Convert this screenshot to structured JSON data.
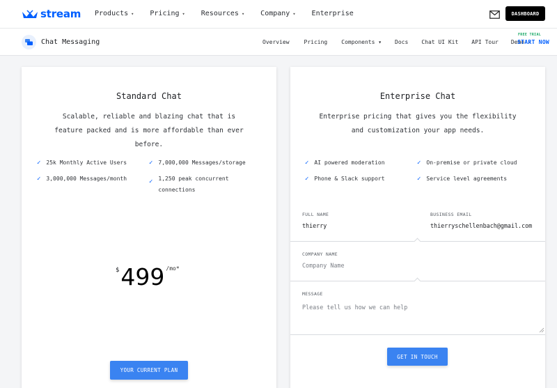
{
  "topnav": {
    "logo_text": "stream",
    "items": [
      {
        "label": "Products",
        "caret": true
      },
      {
        "label": "Pricing",
        "caret": true
      },
      {
        "label": "Resources",
        "caret": true
      },
      {
        "label": "Company",
        "caret": true
      },
      {
        "label": "Enterprise",
        "caret": false
      }
    ],
    "dashboard_label": "DASHBOARD"
  },
  "subnav": {
    "product": "Chat Messaging",
    "items": [
      "Overview",
      "Pricing",
      "Components ▾",
      "Docs",
      "Chat UI Kit",
      "API Tour",
      "Demo ↗"
    ],
    "free_trial": "FREE TRIAL",
    "start_now": "START NOW"
  },
  "standard": {
    "title": "Standard Chat",
    "description": "Scalable, reliable and blazing chat that is feature packed and is more affordable than ever before.",
    "features": [
      "25k Monthly Active Users",
      "7,000,000 Messages/storage",
      "3,000,000 Messages/month",
      "1,250 peak concurrent connections"
    ],
    "currency": "$",
    "price": "499",
    "per": "/mo*",
    "button": "YOUR CURRENT PLAN"
  },
  "enterprise": {
    "title": "Enterprise Chat",
    "description": "Enterprise pricing that gives you the flexibility and customization your app needs.",
    "features": [
      "AI powered moderation",
      "On-premise or private cloud",
      "Phone & Slack support",
      "Service level agreements"
    ],
    "form": {
      "full_name_label": "FULL NAME",
      "full_name_value": "thierry",
      "email_label": "BUSINESS EMAIL",
      "email_value": "thierryschellenbach@gmail.com",
      "company_label": "COMPANY NAME",
      "company_placeholder": "Company Name",
      "message_label": "MESSAGE",
      "message_placeholder": "Please tell us how we can help"
    },
    "button": "GET IN TOUCH"
  },
  "colors": {
    "accent": "#005fff",
    "button": "#3a83f1",
    "check": "#005fff",
    "free_trial": "#17a865"
  }
}
